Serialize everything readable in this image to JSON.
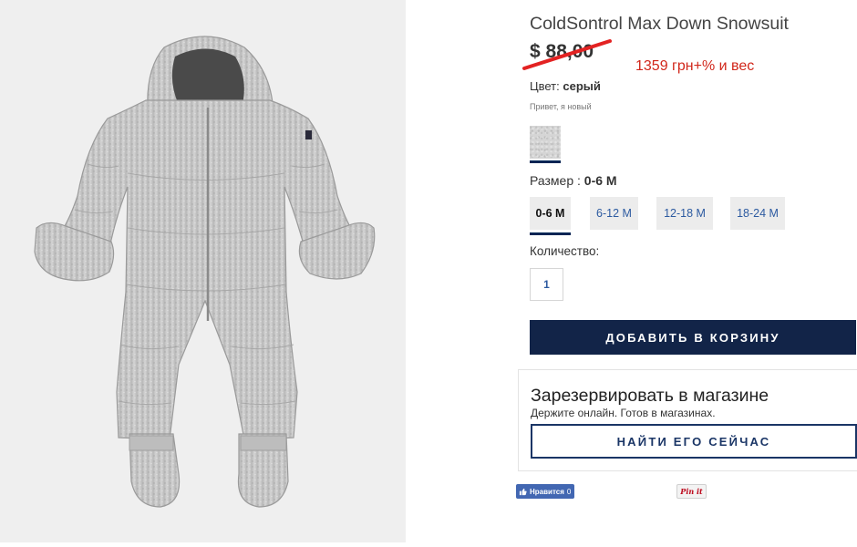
{
  "product": {
    "title": "ColdSontrol Max Down Snowsuit",
    "price": "$ 88,00",
    "note": "1359 грн+% и вес",
    "color_label": "Цвет:",
    "color_value": "серый",
    "hint": "Привет, я новый",
    "size_label": "Размер :",
    "size_value": "0-6 M",
    "sizes": [
      "0-6 M",
      "6-12 M",
      "12-18 M",
      "18-24 M"
    ],
    "quantity_label": "Количество:",
    "quantity_value": "1",
    "add_to_cart": "ДОБАВИТЬ В КОРЗИНУ"
  },
  "reserve": {
    "title": "Зарезервировать в магазине",
    "subtitle": "Держите онлайн. Готов в магазинах.",
    "button": "НАЙТИ ЕГО СЕЙЧАС"
  },
  "social": {
    "like_label": "Нравится",
    "like_count": "0",
    "pin_label": "Pin it"
  },
  "colors": {
    "primary_button": "#122448",
    "accent_blue": "#2c5aa0",
    "strike_red": "#e32222",
    "note_red": "#d1271b"
  }
}
